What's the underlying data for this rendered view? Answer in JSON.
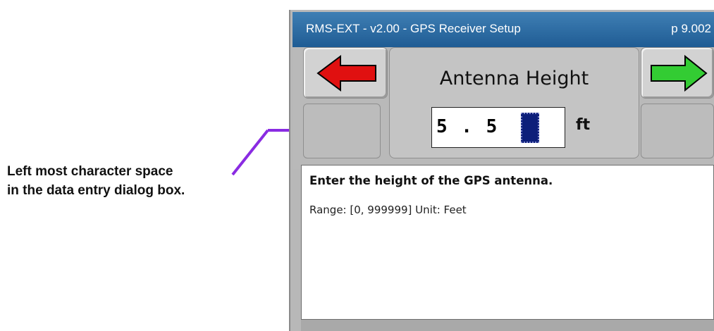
{
  "callout": {
    "line1": "Left most character space",
    "line2": "in the data entry dialog box.",
    "arrow_color": "#8a2be2"
  },
  "titlebar": {
    "title": "RMS-EXT - v2.00 - GPS Receiver Setup",
    "page": "p 9.002",
    "color": "#2a6aa3"
  },
  "nav": {
    "back_icon": "left-arrow-icon",
    "back_color": "#e01010",
    "forward_icon": "right-arrow-icon",
    "forward_color": "#33cc33"
  },
  "field": {
    "label": "Antenna Height",
    "value": "5 . 5",
    "unit": "ft"
  },
  "help": {
    "description": "Enter the height of the GPS antenna.",
    "range": "Range: [0, 999999]  Unit: Feet"
  }
}
